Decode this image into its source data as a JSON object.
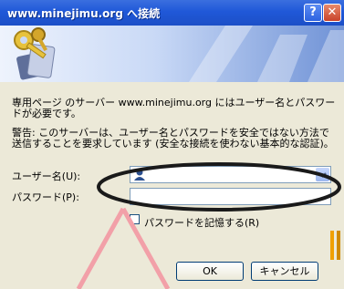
{
  "window": {
    "title": "www.minejimu.org へ接続",
    "help_label": "?",
    "close_label": "✕"
  },
  "dialog": {
    "message1": "専用ページ のサーバー www.minejimu.org にはユーザー名とパスワードが必要です。",
    "message2": "警告: このサーバーは、ユーザー名とパスワードを安全ではない方法で送信することを要求しています (安全な接続を使わない基本的な認証)。",
    "username_label": "ユーザー名(U):",
    "username_value": "",
    "password_label": "パスワード(P):",
    "password_value": "",
    "remember_label": "パスワードを記憶する(R)",
    "remember_checked": false,
    "ok_label": "OK",
    "cancel_label": "キャンセル"
  },
  "icons": {
    "banner": "keys-icon",
    "user": "user-icon",
    "dropdown": "chevron-down-icon"
  },
  "annotation": {
    "ellipse_color": "#1a1a1a",
    "arrow_color": "#f2a0a8",
    "marker_color": "#f0a000"
  }
}
